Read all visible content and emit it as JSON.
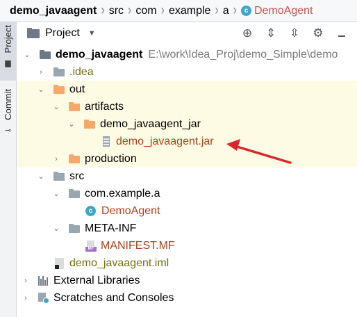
{
  "breadcrumb": {
    "items": [
      "demo_javaagent",
      "src",
      "com",
      "example",
      "a",
      "DemoAgent"
    ]
  },
  "toolstrip": {
    "project_tab": "Project",
    "commit_tab": "Commit"
  },
  "panel": {
    "title": "Project"
  },
  "tree": {
    "root_name": "demo_javaagent",
    "root_path": "E:\\work\\Idea_Proj\\demo_Simple\\demo",
    "idea": ".idea",
    "out": "out",
    "artifacts": "artifacts",
    "artifact_dir": "demo_javaagent_jar",
    "jar": "demo_javaagent.jar",
    "production": "production",
    "src": "src",
    "package": "com.example.a",
    "class": "DemoAgent",
    "meta_inf": "META-INF",
    "manifest": "MANIFEST.MF",
    "iml": "demo_javaagent.iml",
    "external_libraries": "External Libraries",
    "scratches": "Scratches and Consoles"
  },
  "colors": {
    "highlight_row": "#fdfbe3",
    "arrow": "#d9262b",
    "folder_orange": "#f6a868",
    "class_icon": "#3fa7c4"
  }
}
